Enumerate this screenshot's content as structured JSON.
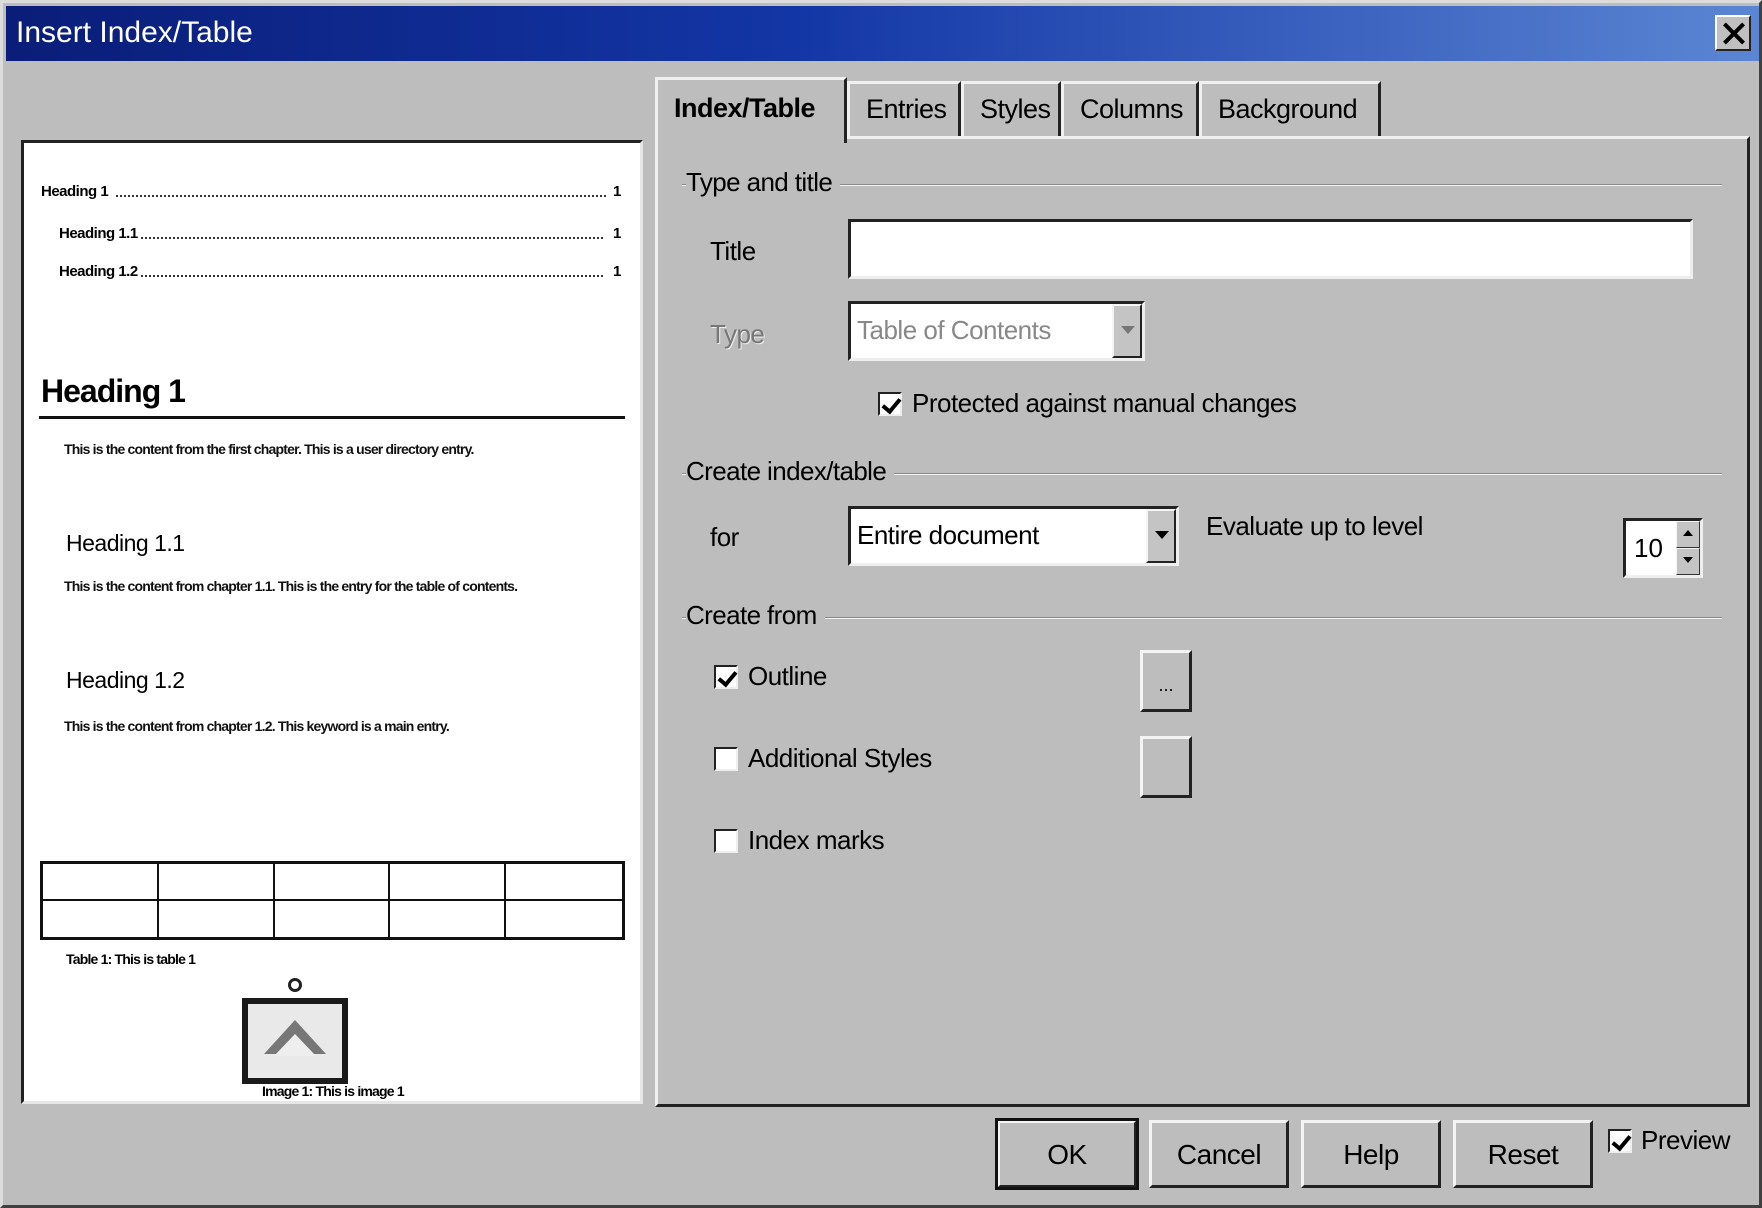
{
  "window": {
    "title": "Insert Index/Table"
  },
  "tabs": [
    {
      "label": "Index/Table",
      "active": true
    },
    {
      "label": "Entries",
      "active": false
    },
    {
      "label": "Styles",
      "active": false
    },
    {
      "label": "Columns",
      "active": false
    },
    {
      "label": "Background",
      "active": false
    }
  ],
  "preview": {
    "toc": [
      {
        "text": "Heading 1",
        "page": "1"
      },
      {
        "text": "Heading 1.1",
        "page": "1"
      },
      {
        "text": "Heading 1.2",
        "page": "1"
      }
    ],
    "heading1": "Heading 1",
    "heading1_text": "This is the content from the first chapter. This is a user directory entry.",
    "heading11": "Heading 1.1",
    "heading11_text": "This is the content from chapter 1.1. This is the entry for the table of contents.",
    "heading12": "Heading 1.2",
    "heading12_text": "This is the content from chapter 1.2. This keyword is a main entry.",
    "table_caption": "Table 1: This is table 1",
    "image_caption": "Image 1: This is image 1"
  },
  "type_and_title": {
    "section_label": "Type and title",
    "title_label": "Title",
    "title_value": "",
    "type_label": "Type",
    "type_value": "Table of Contents",
    "protected_label": "Protected against manual changes",
    "protected_checked": true
  },
  "create_index": {
    "section_label": "Create index/table",
    "for_label": "for",
    "for_value": "Entire document",
    "evaluate_label": "Evaluate up to level",
    "evaluate_value": "10"
  },
  "create_from": {
    "section_label": "Create from",
    "outline_label": "Outline",
    "outline_checked": true,
    "outline_button": "...",
    "additional_styles_label": "Additional Styles",
    "additional_styles_checked": false,
    "index_marks_label": "Index marks",
    "index_marks_checked": false
  },
  "buttons": {
    "ok": "OK",
    "cancel": "Cancel",
    "help": "Help",
    "reset": "Reset",
    "preview_label": "Preview",
    "preview_checked": true
  }
}
